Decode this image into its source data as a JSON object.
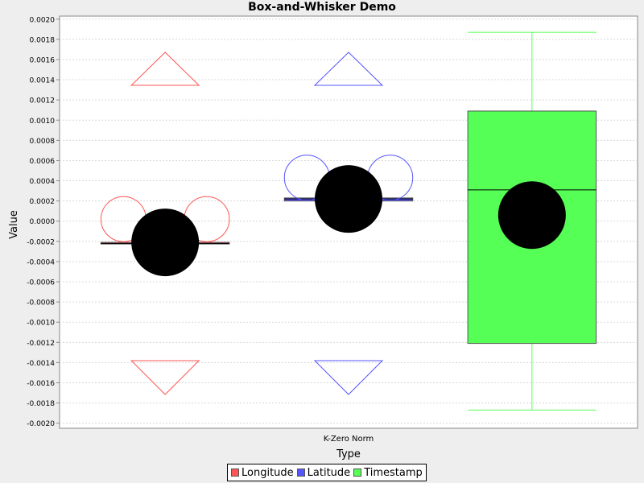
{
  "chart_data": {
    "type": "box",
    "title": "Box-and-Whisker Demo",
    "xlabel": "Type",
    "ylabel": "Value",
    "categories": [
      "K-Zero Norm"
    ],
    "ylim": [
      -0.00205,
      0.00203
    ],
    "yticks": [
      "0.0020",
      "0.0018",
      "0.0016",
      "0.0014",
      "0.0012",
      "0.0010",
      "0.0008",
      "0.0006",
      "0.0004",
      "0.0002",
      "0.0000",
      "-0.0002",
      "-0.0004",
      "-0.0006",
      "-0.0008",
      "-0.0010",
      "-0.0012",
      "-0.0014",
      "-0.0016",
      "-0.0018",
      "-0.0020"
    ],
    "grid": true,
    "legend_position": "bottom",
    "series": [
      {
        "name": "Longitude",
        "color": "#ff5555",
        "q1": -0.00022,
        "q3": -0.00021,
        "median": -0.00022,
        "mean": -0.00021,
        "whisker_high": -0.00022,
        "whisker_low": -0.00022,
        "outliers": [
          2e-05,
          2e-05
        ],
        "far_out_high": true,
        "far_out_low": true
      },
      {
        "name": "Latitude",
        "color": "#5555ff",
        "q1": 0.0002,
        "q3": 0.00023,
        "median": 0.00022,
        "mean": 0.00022,
        "whisker_high": 0.00023,
        "whisker_low": 0.0002,
        "outliers": [
          0.00043,
          0.00043
        ],
        "far_out_high": true,
        "far_out_low": true
      },
      {
        "name": "Timestamp",
        "color": "#55ff55",
        "q1": -0.00121,
        "q3": 0.00109,
        "median": 0.00031,
        "mean": 6e-05,
        "whisker_high": 0.00187,
        "whisker_low": -0.00187,
        "outliers": [],
        "far_out_high": false,
        "far_out_low": false
      }
    ]
  }
}
